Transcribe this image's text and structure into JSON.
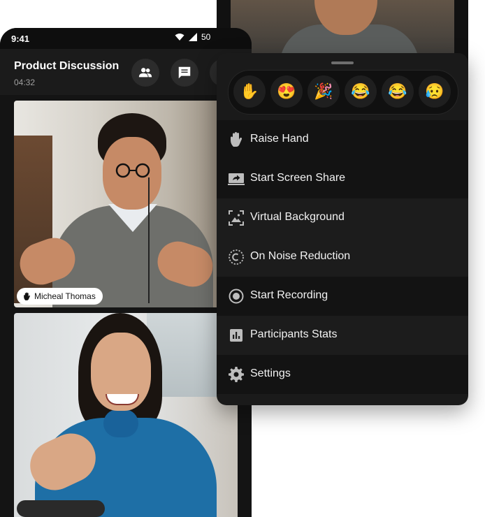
{
  "status_bar": {
    "time": "9:41",
    "battery": "50"
  },
  "header": {
    "title": "Product Discussion",
    "timer": "04:32"
  },
  "participants": [
    {
      "name": "Micheal Thomas",
      "hand_raised": true
    }
  ],
  "reactions": [
    {
      "emoji": "✋",
      "name": "raise-hand-reaction"
    },
    {
      "emoji": "😍",
      "name": "heart-eyes-reaction"
    },
    {
      "emoji": "🎉",
      "name": "party-popper-reaction"
    },
    {
      "emoji": "😂",
      "name": "laughing-reaction"
    },
    {
      "emoji": "😂",
      "name": "tears-of-joy-reaction"
    },
    {
      "emoji": "😥",
      "name": "sad-reaction"
    }
  ],
  "menu": {
    "items": [
      {
        "label": "Raise Hand",
        "icon": "hand-icon"
      },
      {
        "label": "Start Screen Share",
        "icon": "screen-share-icon"
      },
      {
        "label": "Virtual Background",
        "icon": "virtual-background-icon"
      },
      {
        "label": "On Noise Reduction",
        "icon": "noise-reduction-icon"
      },
      {
        "label": "Start Recording",
        "icon": "record-icon"
      },
      {
        "label": "Participants Stats",
        "icon": "stats-icon"
      },
      {
        "label": "Settings",
        "icon": "gear-icon"
      }
    ]
  },
  "colors": {
    "menu_bg": "#1a1a1a",
    "phone_bg": "#141414",
    "text": "#f2f2f2"
  }
}
